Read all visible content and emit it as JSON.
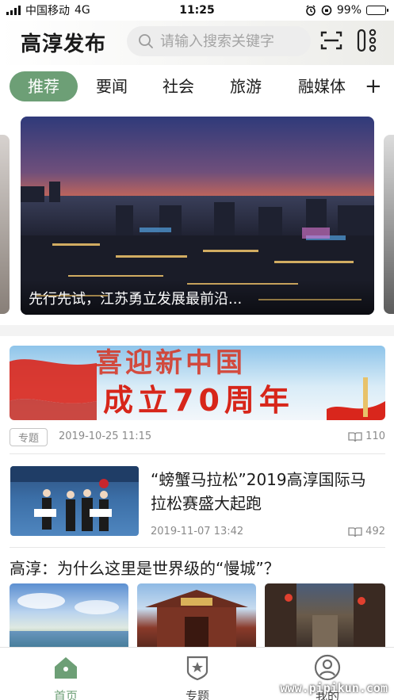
{
  "status_bar": {
    "carrier": "中国移动",
    "network": "4G",
    "time": "11:25",
    "battery": "99%",
    "battery_level": 0.99
  },
  "header": {
    "brand": "高淳发布",
    "search_placeholder": "请输入搜索关键字"
  },
  "tabs": {
    "items": [
      "推荐",
      "要闻",
      "社会",
      "旅游",
      "融媒体"
    ],
    "active_index": 0,
    "add_label": "+"
  },
  "hero": {
    "caption": "先行先试，江苏勇立发展最前沿..."
  },
  "banner": {
    "line1": "喜迎新中国",
    "line2": "成立70周年",
    "tag": "专题",
    "date": "2019-10-25 11:15",
    "views": "110"
  },
  "news": [
    {
      "title": "“螃蟹马拉松”2019高淳国际马拉松赛盛大起跑",
      "date": "2019-11-07 13:42",
      "views": "492"
    }
  ],
  "gallery": {
    "title": "高淳：为什么这里是世界级的“慢城”？"
  },
  "bottom_nav": {
    "items": [
      {
        "label": "首页",
        "icon": "home-icon",
        "active": true
      },
      {
        "label": "专题",
        "icon": "star-badge-icon",
        "active": false
      },
      {
        "label": "我的",
        "icon": "user-icon",
        "active": false
      }
    ]
  },
  "watermark": "www.pipikun.com",
  "colors": {
    "accent": "#6d9f76",
    "text": "#1c1c1c",
    "muted": "#8a8a8a"
  }
}
